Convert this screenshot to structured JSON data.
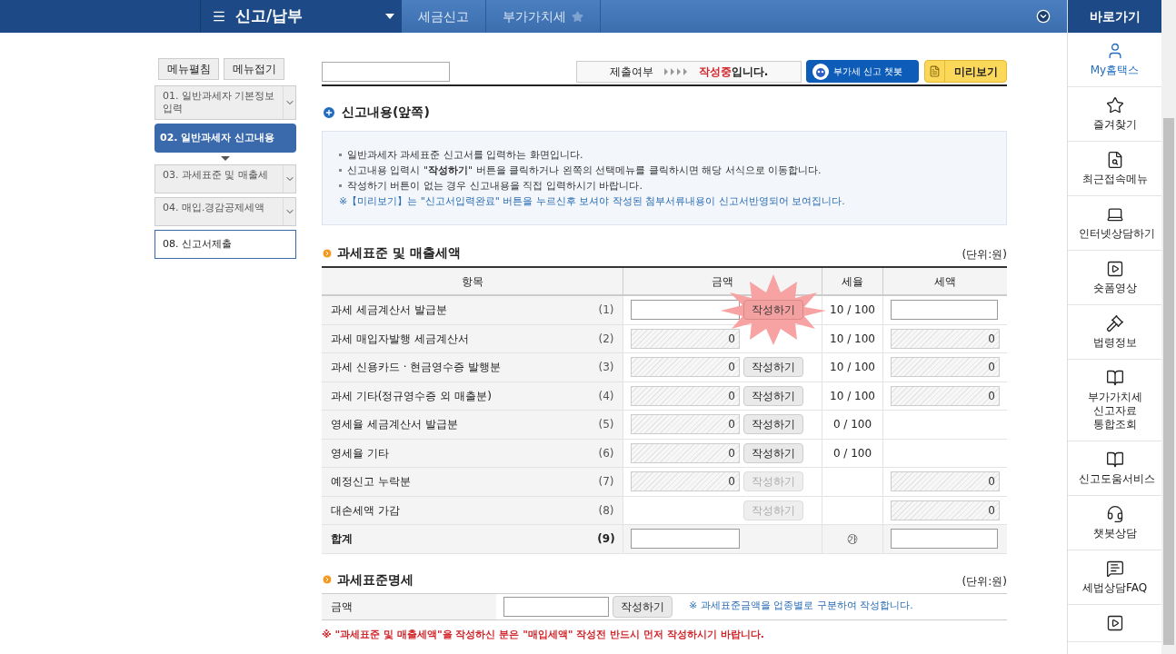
{
  "topbar": {
    "menu_title": "신고/납부",
    "breadcrumbs": [
      "세금신고",
      "부가가치세"
    ],
    "shortcut_title": "바로가기"
  },
  "sidebar": {
    "buttons": [
      "메뉴펼침",
      "메뉴접기"
    ],
    "items": [
      {
        "label": "01. 일반과세자 기본정보 입력",
        "kind": "group",
        "selected": false
      },
      {
        "label": "02. 일반과세자 신고내용",
        "kind": "current",
        "selected": true
      },
      {
        "label": "03. 과세표준 및 매출세",
        "kind": "group",
        "selected": false
      },
      {
        "label": "04. 매입.경감공제세액",
        "kind": "group",
        "selected": false
      },
      {
        "label": "08. 신고서제출",
        "kind": "link",
        "selected": false
      }
    ]
  },
  "status": {
    "label": "제출여부",
    "state": "작성중",
    "suffix": "입니다."
  },
  "chatbot_button": "부가세 신고 챗봇",
  "preview_button": "미리보기",
  "section_title": "신고내용(앞쪽)",
  "notice": {
    "bullets": [
      "일반과세자 과세표준 신고서를 입력하는 화면입니다.",
      "신고내용 입력시 \"**작성하기**\" 버튼을 클릭하거나 왼쪽의 선택메뉴를 클릭하시면 해당 서식으로 이동합니다.",
      "작성하기 버튼이 없는 경우 신고내용을 직접 입력하시기 바랍니다."
    ],
    "note": "※【미리보기】는 \"신고서입력완료\" 버튼을 누르신후 보셔야 작성된 첨부서류내용이 신고서반영되어 보여집니다."
  },
  "sales_table": {
    "title": "과세표준 및 매출세액",
    "unit": "(단위:원)",
    "columns": [
      "항목",
      "금액",
      "세율",
      "세액"
    ],
    "rows": [
      {
        "label": "과세 세금계산서 발급분",
        "no": "(1)",
        "amount": {
          "kind": "input"
        },
        "button": {
          "label": "작성하기",
          "disabled": false,
          "highlighted": true
        },
        "rate": "10 / 100",
        "tax": {
          "kind": "input"
        },
        "total": false
      },
      {
        "label": "과세 매입자발행 세금계산서",
        "no": "(2)",
        "total": false,
        "amount": {
          "kind": "readonly",
          "value": "0"
        },
        "rate": "10 / 100",
        "tax": {
          "kind": "readonly",
          "value": "0"
        }
      },
      {
        "label": "과세 신용카드 · 현금영수증 발행분",
        "no": "(3)",
        "total": false,
        "amount": {
          "kind": "readonly",
          "value": "0"
        },
        "button": {
          "label": "작성하기",
          "disabled": false,
          "highlighted": false
        },
        "rate": "10 / 100",
        "tax": {
          "kind": "readonly",
          "value": "0"
        }
      },
      {
        "label": "과세 기타(정규영수증 외 매출분)",
        "no": "(4)",
        "total": false,
        "amount": {
          "kind": "readonly",
          "value": "0"
        },
        "button": {
          "label": "작성하기",
          "disabled": false,
          "highlighted": false
        },
        "rate": "10 / 100",
        "tax": {
          "kind": "readonly",
          "value": "0"
        }
      },
      {
        "label": "영세율 세금계산서 발급분",
        "no": "(5)",
        "total": false,
        "amount": {
          "kind": "readonly",
          "value": "0"
        },
        "button": {
          "label": "작성하기",
          "disabled": false,
          "highlighted": false
        },
        "rate": "0 / 100"
      },
      {
        "label": "영세율 기타",
        "no": "(6)",
        "total": false,
        "amount": {
          "kind": "readonly",
          "value": "0"
        },
        "button": {
          "label": "작성하기",
          "disabled": false,
          "highlighted": false
        },
        "rate": "0 / 100"
      },
      {
        "label": "예정신고 누락분",
        "no": "(7)",
        "total": false,
        "amount": {
          "kind": "readonly",
          "value": "0"
        },
        "button": {
          "label": "작성하기",
          "disabled": true,
          "highlighted": false
        },
        "tax": {
          "kind": "readonly",
          "value": "0"
        }
      },
      {
        "label": "대손세액 가감",
        "no": "(8)",
        "total": false,
        "button": {
          "label": "작성하기",
          "disabled": true,
          "highlighted": false
        },
        "tax": {
          "kind": "readonly",
          "value": "0"
        }
      },
      {
        "label": "합계",
        "no": "(9)",
        "total": true,
        "amount": {
          "kind": "input"
        },
        "rate": "㉮",
        "tax": {
          "kind": "input"
        }
      }
    ]
  },
  "base_table": {
    "title": "과세표준명세",
    "unit": "(단위:원)",
    "row_label": "금액",
    "button": "작성하기",
    "hint": "※ 과세표준금액을 업종별로 구분하여 작성합니다.",
    "warning": "※ \"과세표준 및 매출세액\"을 작성하신 분은 \"매입세액\" 작성전 반드시 먼저 작성하시기 바랍니다."
  },
  "quick_links": [
    {
      "label": "My홈택스",
      "selected": true
    },
    {
      "label": "즐겨찾기",
      "selected": false
    },
    {
      "label": "최근접속메뉴",
      "selected": false
    },
    {
      "label": "인터넷상담하기",
      "selected": false
    },
    {
      "label": "숏폼영상",
      "selected": false
    },
    {
      "label": "법령정보",
      "selected": false
    },
    {
      "label": "부가가치세 신고자료 통합조회",
      "selected": false
    },
    {
      "label": "신고도움서비스",
      "selected": false
    },
    {
      "label": "챗봇상담",
      "selected": false
    },
    {
      "label": "세법상담FAQ",
      "selected": false
    },
    {
      "selected": false
    }
  ]
}
